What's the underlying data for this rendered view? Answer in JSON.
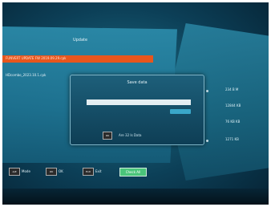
{
  "window": {
    "panel_title": "Update",
    "selected_row": "FUNVERT UPDATE FW 2019.09.29.cpk",
    "file_row": "HDcombo_2023.10.1.cpk"
  },
  "values": [
    "234 B M",
    "12844 KB",
    "76 KB KB",
    "1271 KB"
  ],
  "dialog": {
    "title": "Save data",
    "input_value": "",
    "confirm_button": "",
    "ok_icon": "OK",
    "hint": "Are 32 Is Data"
  },
  "footer": {
    "key1_icon": "A/Z",
    "key1_label": "Mode",
    "key2_icon": "OK",
    "key2_label": "OK",
    "key3_icon": "Exit",
    "key3_label": "Exit",
    "green_label": "Check All"
  },
  "colors": {
    "accent_orange": "#e8561d",
    "accent_green": "#4ac47a",
    "panel_blue": "#2c8cab"
  }
}
